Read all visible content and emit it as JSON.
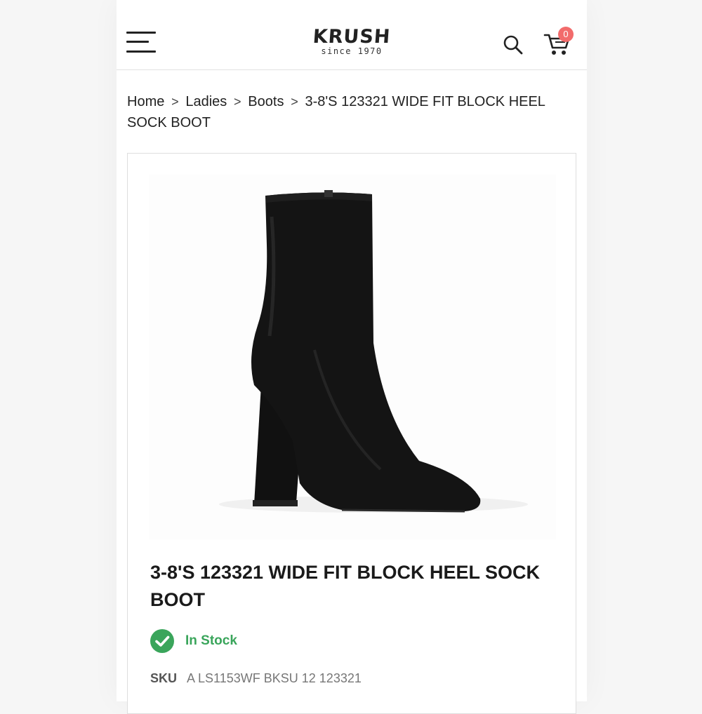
{
  "header": {
    "logo_word": "KRUSH",
    "logo_tagline": "since 1970",
    "cart_count": "0",
    "icons": [
      "menu-icon",
      "search-icon",
      "cart-icon"
    ]
  },
  "breadcrumb": {
    "items": [
      "Home",
      "Ladies",
      "Boots"
    ],
    "current": "3-8'S 123321 WIDE FIT BLOCK HEEL SOCK BOOT",
    "separator": ">"
  },
  "product": {
    "title": "3-8'S 123321 WIDE FIT BLOCK HEEL SOCK BOOT",
    "stock_status": "In Stock",
    "sku_label": "SKU",
    "sku_value": "A LS1153WF BKSU 12 123321"
  },
  "colors": {
    "accent_badge": "#f26b6b",
    "in_stock": "#3aa55b",
    "text": "#222222"
  }
}
